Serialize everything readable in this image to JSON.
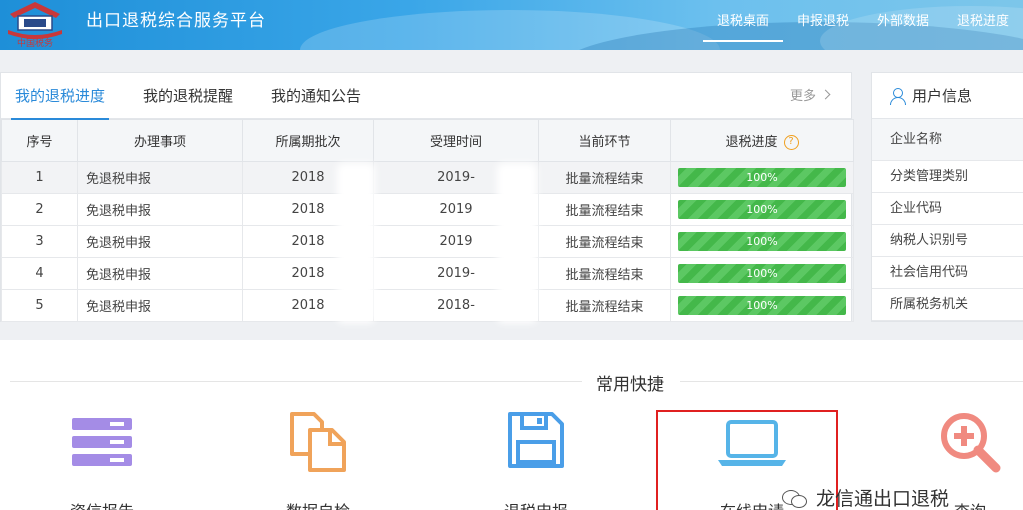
{
  "header": {
    "platform_name": "出口退税综合服务平台",
    "logo_text": "中国税务",
    "nav": [
      {
        "label": "退税桌面",
        "active": true
      },
      {
        "label": "申报退税",
        "active": false
      },
      {
        "label": "外部数据",
        "active": false
      },
      {
        "label": "退税进度",
        "active": false
      }
    ]
  },
  "main_panel": {
    "tabs": [
      {
        "label": "我的退税进度",
        "active": true
      },
      {
        "label": "我的退税提醒",
        "active": false
      },
      {
        "label": "我的通知公告",
        "active": false
      }
    ],
    "more_label": "更多",
    "columns": [
      "序号",
      "办理事项",
      "所属期批次",
      "受理时间",
      "当前环节",
      "退税进度"
    ],
    "help_glyph": "?",
    "rows": [
      {
        "no": "1",
        "item": "免退税申报",
        "period": "2018",
        "time": "2019-",
        "stage": "批量流程结束",
        "progress": "100%"
      },
      {
        "no": "2",
        "item": "免退税申报",
        "period": "2018",
        "time": "2019",
        "stage": "批量流程结束",
        "progress": "100%"
      },
      {
        "no": "3",
        "item": "免退税申报",
        "period": "2018",
        "time": "2019",
        "stage": "批量流程结束",
        "progress": "100%"
      },
      {
        "no": "4",
        "item": "免退税申报",
        "period": "2018",
        "time": "2019-",
        "stage": "批量流程结束",
        "progress": "100%"
      },
      {
        "no": "5",
        "item": "免退税申报",
        "period": "2018",
        "time": "2018-",
        "stage": "批量流程结束",
        "progress": "100%"
      }
    ]
  },
  "user_panel": {
    "title": "用户信息",
    "fields": [
      "企业名称",
      "分类管理类别",
      "企业代码",
      "纳税人识别号",
      "社会信用代码",
      "所属税务机关"
    ]
  },
  "shortcuts": {
    "title": "常用快捷",
    "items": [
      {
        "label": "资信报告",
        "icon": "server-list-icon",
        "color": "#a48ce6"
      },
      {
        "label": "数据自检",
        "icon": "documents-icon",
        "color": "#f0a35a"
      },
      {
        "label": "退税申报",
        "icon": "floppy-save-icon",
        "color": "#4a9ee8"
      },
      {
        "label": "在线申请",
        "icon": "laptop-icon",
        "color": "#56b4e8"
      },
      {
        "label": "查询",
        "icon": "zoom-in-icon",
        "color": "#f08a80"
      }
    ]
  },
  "watermark": {
    "text": "龙信通出口退税"
  },
  "colors": {
    "accent": "#2a8ad9",
    "progress": "#4cbb52",
    "highlight": "#e02020"
  }
}
